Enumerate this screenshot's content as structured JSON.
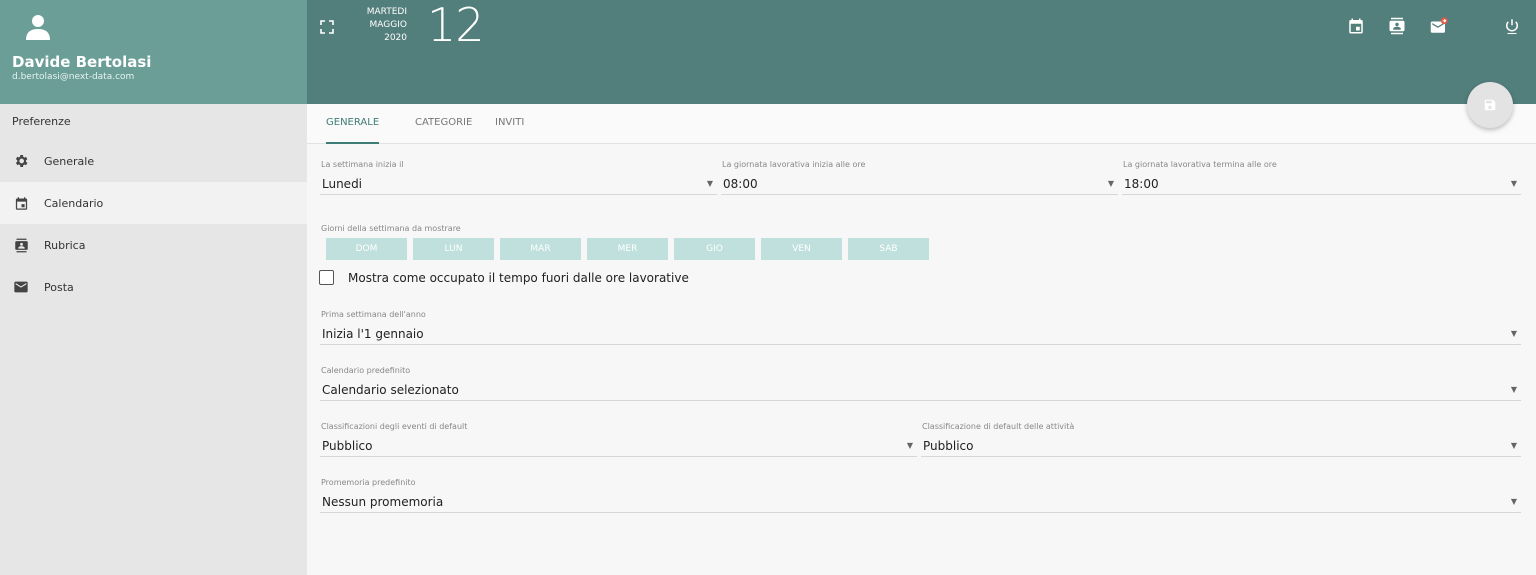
{
  "user": {
    "name": "Davide Bertolasi",
    "email": "d.bertolasi@next-data.com"
  },
  "sidebar": {
    "title": "Preferenze",
    "items": [
      {
        "label": "Generale",
        "icon": "gear-icon",
        "active": false
      },
      {
        "label": "Calendario",
        "icon": "calendar-icon",
        "active": true
      },
      {
        "label": "Rubrica",
        "icon": "contacts-icon",
        "active": false
      },
      {
        "label": "Posta",
        "icon": "mail-icon",
        "active": false
      }
    ]
  },
  "header": {
    "weekday": "MARTEDI",
    "month": "MAGGIO",
    "year": "2020",
    "day": "12"
  },
  "tabs": [
    {
      "label": "GENERALE"
    },
    {
      "label": "CATEGORIE"
    },
    {
      "label": "INVITI"
    }
  ],
  "form": {
    "week_start": {
      "label": "La settimana inizia il",
      "value": "Lunedi"
    },
    "work_start": {
      "label": "La giornata lavorativa inizia alle ore",
      "value": "08:00"
    },
    "work_end": {
      "label": "La giornata lavorativa termina alle ore",
      "value": "18:00"
    },
    "days_label": "Giorni della settimana da mostrare",
    "days": [
      "DOM",
      "LUN",
      "MAR",
      "MER",
      "GIO",
      "VEN",
      "SAB"
    ],
    "busy_checkbox": {
      "label": "Mostra come occupato il tempo fuori dalle ore lavorative",
      "checked": false
    },
    "first_week": {
      "label": "Prima settimana dell'anno",
      "value": "Inizia l'1 gennaio"
    },
    "default_calendar": {
      "label": "Calendario predefinito",
      "value": "Calendario selezionato"
    },
    "event_class": {
      "label": "Classificazioni degli eventi di default",
      "value": "Pubblico"
    },
    "task_class": {
      "label": "Classificazione di default delle attività",
      "value": "Pubblico"
    },
    "reminder": {
      "label": "Promemoria predefinito",
      "value": "Nessun promemoria"
    }
  },
  "colors": {
    "header": "#527e7b",
    "user_box": "#6a9e97",
    "accent": "#3e7c76",
    "day_chip": "#bfe0dc"
  }
}
